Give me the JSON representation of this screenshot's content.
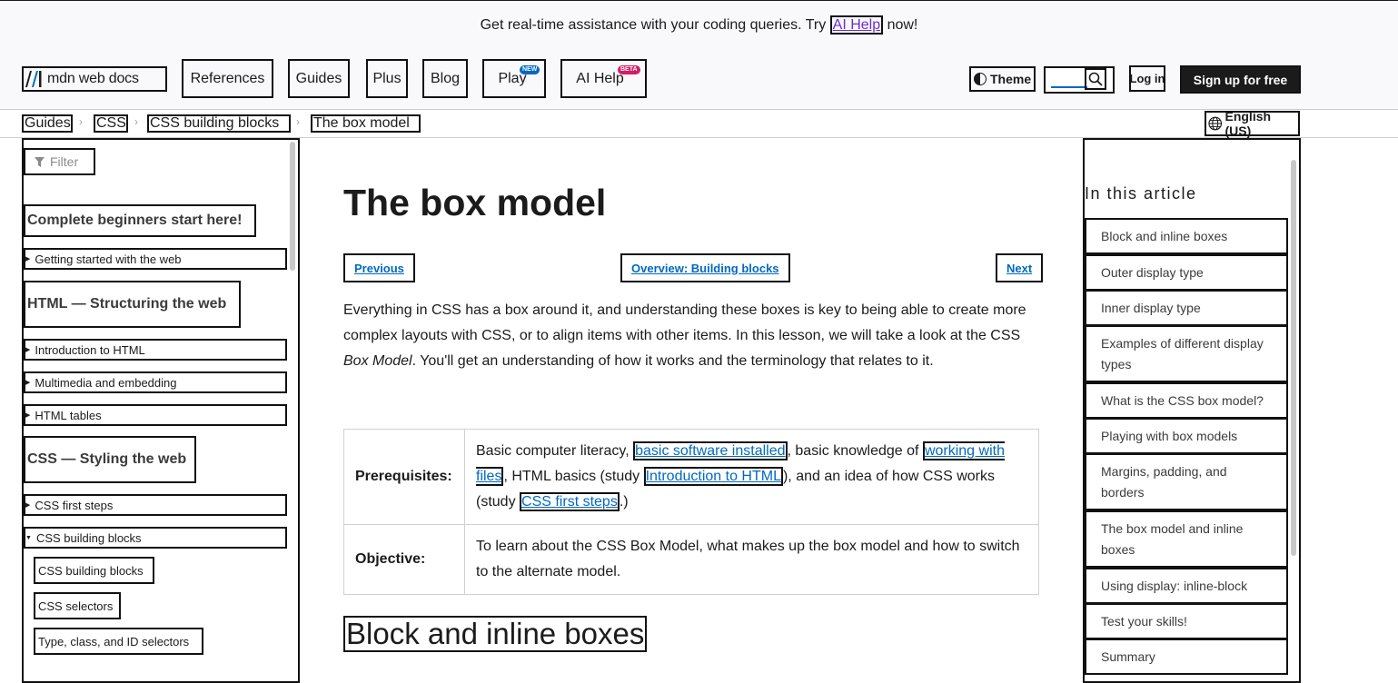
{
  "banner": {
    "text_before": "Get real-time assistance with your coding queries. Try ",
    "link": "AI Help",
    "text_after": " now!"
  },
  "header": {
    "logo_text": "mdn web docs",
    "nav": {
      "references": "References",
      "guides": "Guides",
      "plus": "Plus",
      "blog": "Blog",
      "play": "Play",
      "play_badge": "NEW",
      "ai_help": "AI Help",
      "ai_help_badge": "BETA"
    },
    "theme": "Theme",
    "search_value": "",
    "login": "Log in",
    "signup": "Sign up for free"
  },
  "breadcrumb": {
    "items": [
      "Guides",
      "CSS",
      "CSS building blocks",
      "The box model"
    ],
    "language": "English (US)"
  },
  "sidebar": {
    "filter_placeholder": "Filter",
    "headings": [
      "Complete beginners start here!",
      "HTML — Structuring the web",
      "CSS — Styling the web"
    ],
    "items": [
      "Getting started with the web",
      "Introduction to HTML",
      "Multimedia and embedding",
      "HTML tables",
      "CSS first steps",
      "CSS building blocks"
    ],
    "subitems": [
      "CSS building blocks",
      "CSS selectors",
      "Type, class, and ID selectors"
    ]
  },
  "main": {
    "title": "The box model",
    "prev": "Previous",
    "overview": "Overview: Building blocks",
    "next": "Next",
    "intro_1": "Everything in CSS has a box around it, and understanding these boxes is key to being able to create more complex layouts with CSS, or to align items with other items. In this lesson, we will take a look at the CSS ",
    "intro_em": "Box Model",
    "intro_2": ". You'll get an understanding of how it works and the terminology that relates to it.",
    "prereq_label": "Prerequisites:",
    "prereq_1": "Basic computer literacy, ",
    "prereq_link_1": "basic software installed",
    "prereq_2": ", basic knowledge of ",
    "prereq_link_2": "working with files",
    "prereq_3": ", HTML basics (study ",
    "prereq_link_3": "Introduction to HTML",
    "prereq_4": "), and an idea of how CSS works (study ",
    "prereq_link_4": "CSS first steps",
    "prereq_5": ".)",
    "objective_label": "Objective:",
    "objective_text": "To learn about the CSS Box Model, what makes up the box model and how to switch to the alternate model.",
    "h2": "Block and inline boxes"
  },
  "toc": {
    "title": "In this article",
    "items": [
      "Block and inline boxes",
      "Outer display type",
      "Inner display type",
      "Examples of different display types",
      "What is the CSS box model?",
      "Playing with box models",
      "Margins, padding, and borders",
      "The box model and inline boxes",
      "Using display: inline-block",
      "Test your skills!",
      "Summary"
    ]
  },
  "colors": {
    "link": "#0069c2",
    "visited_link": "#6e2bd9",
    "new_badge": "#0069c2",
    "beta_badge": "#d41d66",
    "signup_bg": "#1b1b1b"
  }
}
